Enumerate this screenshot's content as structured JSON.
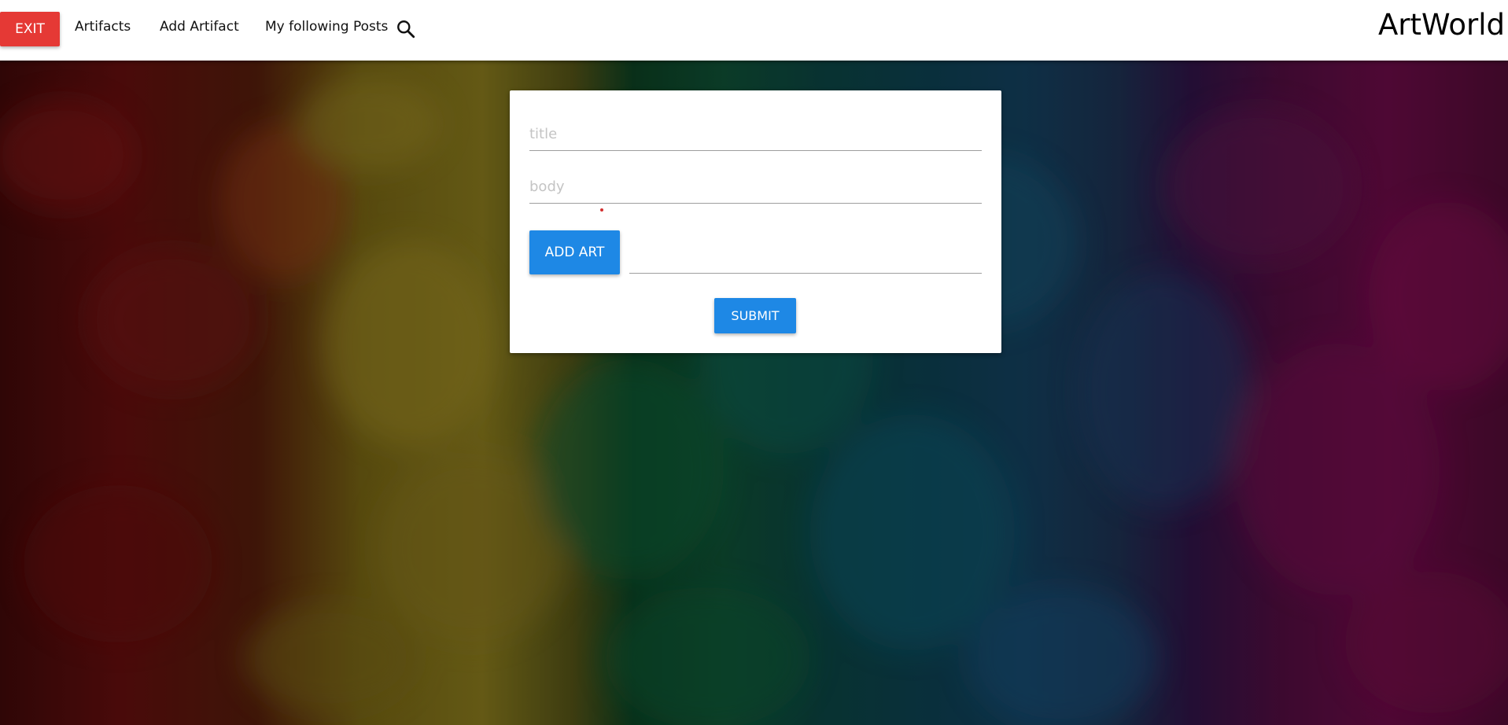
{
  "nav": {
    "exit_label": "EXIT",
    "links": [
      {
        "label": "Artifacts"
      },
      {
        "label": "Add Artifact"
      },
      {
        "label": "My following Posts"
      }
    ],
    "search_icon": "search-icon",
    "brand": "ArtWorld"
  },
  "form": {
    "title_placeholder": "title",
    "title_value": "",
    "body_placeholder": "body",
    "body_value": "",
    "add_art_label": "ADD ART",
    "file_path_value": "",
    "submit_label": "SUBMIT"
  },
  "colors": {
    "exit_button": "#e53935",
    "primary_button": "#1e88e5",
    "navbar_bg": "#ffffff",
    "card_bg": "#ffffff"
  },
  "background": {
    "description_icon": "rainbow-smoke-background"
  }
}
